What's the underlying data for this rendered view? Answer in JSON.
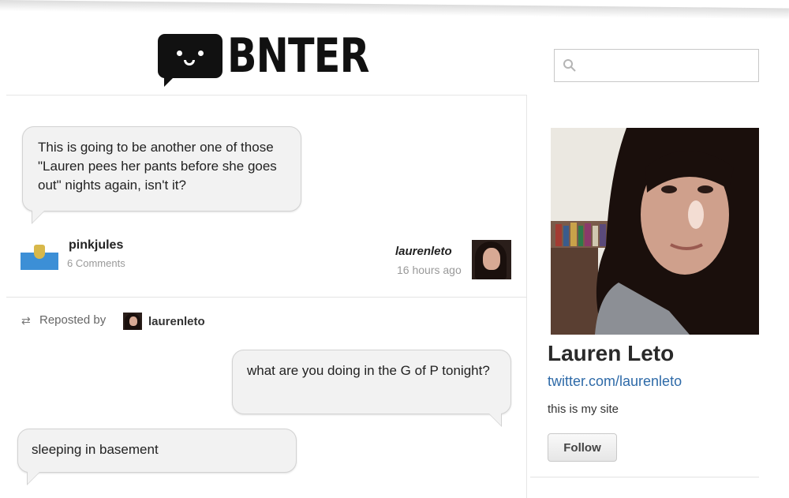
{
  "header": {
    "logo_text": "BNTER",
    "search": {
      "placeholder": "",
      "value": ""
    }
  },
  "post": {
    "text": "This is going to be another one of those \"Lauren pees her pants before she goes out\" nights again, isn't it?",
    "author": {
      "name": "pinkjules",
      "comments": "6 Comments",
      "icon": "san-marino-flag-icon"
    },
    "recipient": {
      "name": "laurenleto",
      "time": "16 hours ago"
    }
  },
  "repost": {
    "label": "Reposted by",
    "user": "laurenleto",
    "messages": [
      {
        "text": "what are you doing in the G of P tonight?",
        "side": "right"
      },
      {
        "text": "sleeping in basement",
        "side": "left"
      }
    ]
  },
  "profile": {
    "name": "Lauren Leto",
    "link": "twitter.com/laurenleto",
    "bio": "this is my site",
    "follow_label": "Follow"
  }
}
